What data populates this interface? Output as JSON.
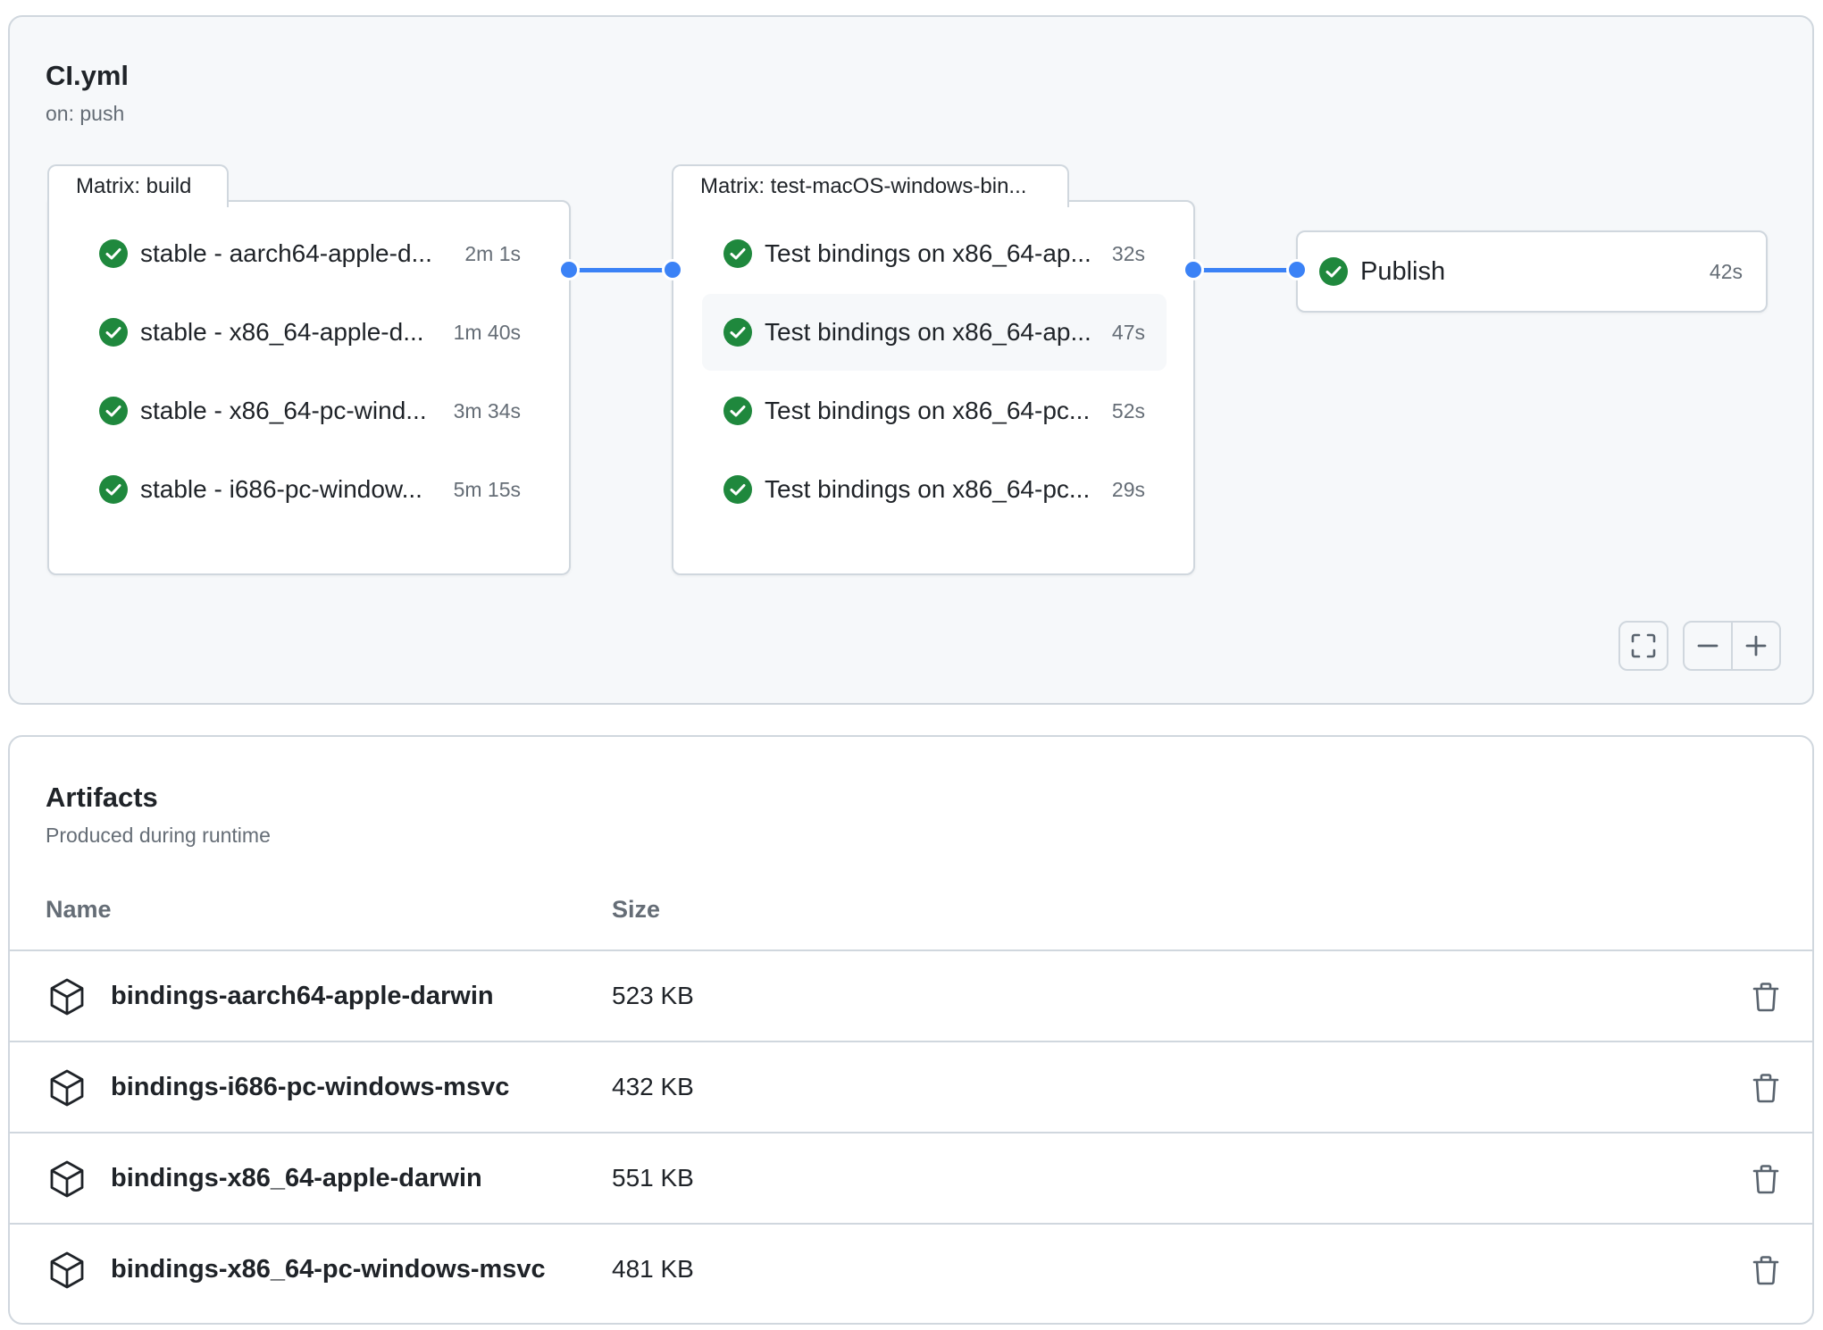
{
  "workflow": {
    "title": "CI.yml",
    "trigger": "on: push"
  },
  "matrix_build": {
    "label": "Matrix: build",
    "jobs": [
      {
        "name": "stable - aarch64-apple-d...",
        "duration": "2m 1s",
        "status": "success"
      },
      {
        "name": "stable - x86_64-apple-d...",
        "duration": "1m 40s",
        "status": "success"
      },
      {
        "name": "stable - x86_64-pc-wind...",
        "duration": "3m 34s",
        "status": "success"
      },
      {
        "name": "stable - i686-pc-window...",
        "duration": "5m 15s",
        "status": "success"
      }
    ]
  },
  "matrix_test": {
    "label": "Matrix: test-macOS-windows-bin...",
    "jobs": [
      {
        "name": "Test bindings on x86_64-ap...",
        "duration": "32s",
        "status": "success"
      },
      {
        "name": "Test bindings on x86_64-ap...",
        "duration": "47s",
        "status": "success"
      },
      {
        "name": "Test bindings on x86_64-pc...",
        "duration": "52s",
        "status": "success"
      },
      {
        "name": "Test bindings on x86_64-pc...",
        "duration": "29s",
        "status": "success"
      }
    ]
  },
  "publish_job": {
    "name": "Publish",
    "duration": "42s",
    "status": "success"
  },
  "graph_controls": {
    "icons": [
      "fullscreen-icon",
      "zoom-out-icon",
      "zoom-in-icon"
    ]
  },
  "artifacts": {
    "title": "Artifacts",
    "subtitle": "Produced during runtime",
    "columns": {
      "name": "Name",
      "size": "Size"
    },
    "rows": [
      {
        "name": "bindings-aarch64-apple-darwin",
        "size": "523 KB"
      },
      {
        "name": "bindings-i686-pc-windows-msvc",
        "size": "432 KB"
      },
      {
        "name": "bindings-x86_64-apple-darwin",
        "size": "551 KB"
      },
      {
        "name": "bindings-x86_64-pc-windows-msvc",
        "size": "481 KB"
      }
    ]
  },
  "colors": {
    "success": "#1f883d",
    "connector": "#3b82f6",
    "border": "#d0d7de",
    "muted_text": "#656d76",
    "panel_bg": "#f6f8fa"
  }
}
